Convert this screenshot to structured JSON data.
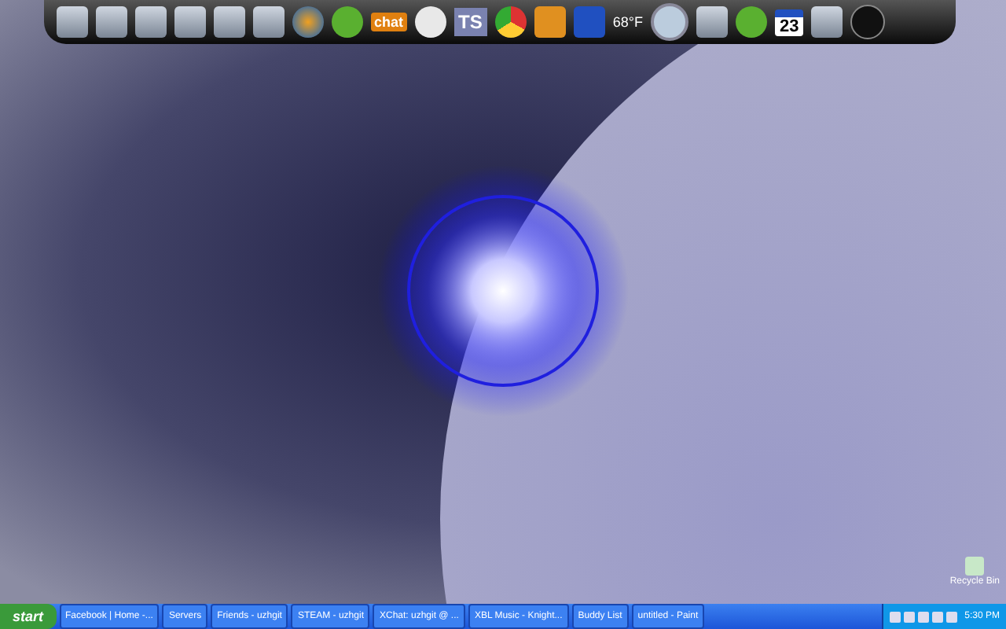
{
  "dock": {
    "chat_logo": "chat",
    "ts_logo": "TS",
    "weather_temp": "68°F",
    "calendar_day": "23"
  },
  "desktop_icons": [
    {
      "label": "Recycle Bin"
    }
  ],
  "taskbar": {
    "start": "start",
    "tasks": [
      {
        "label": "Facebook | Home -...",
        "selected": false
      },
      {
        "label": "Servers",
        "selected": false
      },
      {
        "label": "Friends - uzhgit",
        "selected": false
      },
      {
        "label": "STEAM - uzhgit",
        "selected": false
      },
      {
        "label": "XChat: uzhgit @ ...",
        "selected": false
      },
      {
        "label": "XBL Music - Knight...",
        "selected": false
      },
      {
        "label": "Buddy List",
        "selected": false
      },
      {
        "label": "untitled - Paint",
        "selected": false
      }
    ],
    "clock": "5:30 PM"
  }
}
